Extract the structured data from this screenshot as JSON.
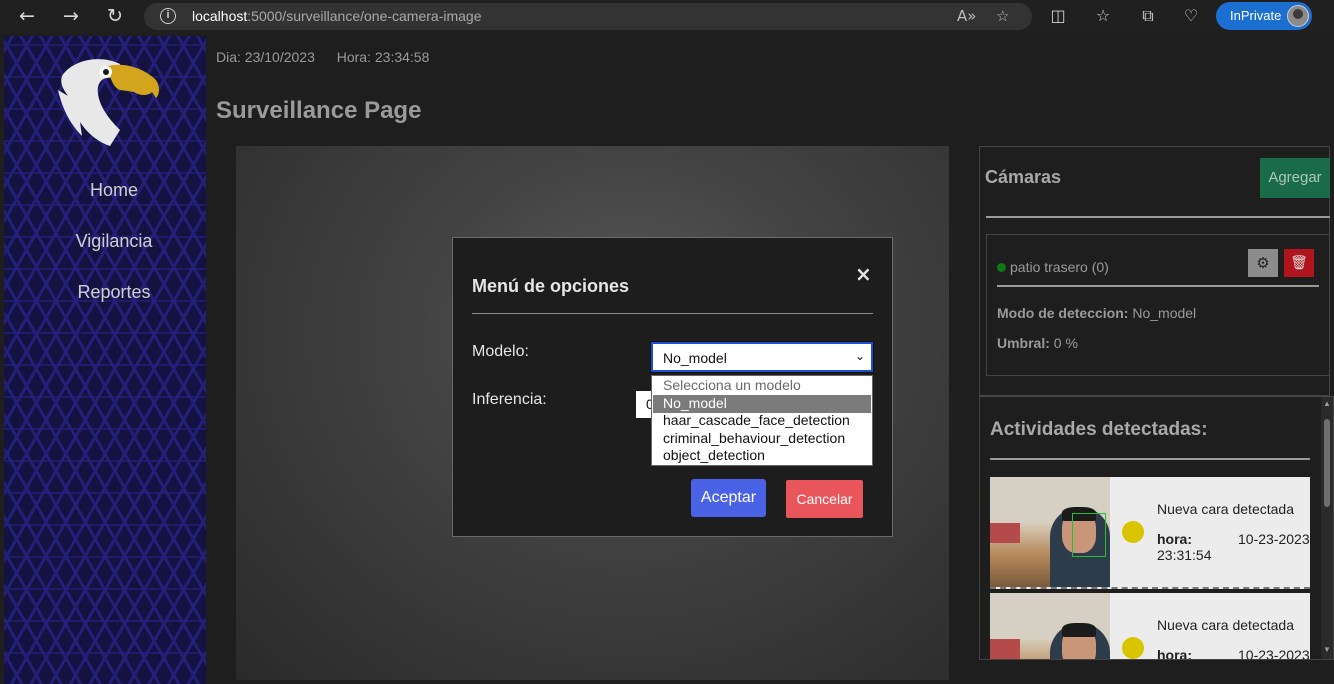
{
  "browser": {
    "url_host": "localhost",
    "url_path": ":5000/surveillance/one-camera-image",
    "inprivate_label": "InPrivate"
  },
  "sidebar": {
    "items": [
      {
        "label": "Home"
      },
      {
        "label": "Vigilancia"
      },
      {
        "label": "Reportes"
      }
    ]
  },
  "header": {
    "date": "Dia: 23/10/2023",
    "time": "Hora: 23:34:58",
    "title": "Surveillance Page"
  },
  "cameras": {
    "title": "Cámaras",
    "add_label": "Agregar",
    "card": {
      "name": "patio trasero (0)",
      "mode_label": "Modo de deteccion:",
      "mode_value": "No_model",
      "threshold_label": "Umbral:",
      "threshold_value": "0 %"
    }
  },
  "activities": {
    "title": "Actividades detectadas:",
    "items": [
      {
        "text": "Nueva cara detectada",
        "hora_label": "hora:",
        "date": "10-23-2023",
        "time": "23:31:54"
      },
      {
        "text": "Nueva cara detectada",
        "hora_label": "hora:",
        "date": "10-23-2023",
        "time": ""
      }
    ]
  },
  "modal": {
    "title": "Menú de opciones",
    "close": "×",
    "model_label": "Modelo:",
    "model_value": "No_model",
    "inference_label": "Inferencia:",
    "inference_value": "0",
    "options": [
      "Selecciona un modelo",
      "No_model",
      "haar_cascade_face_detection",
      "criminal_behaviour_detection",
      "object_detection"
    ],
    "selected_option": "No_model",
    "accept_label": "Aceptar",
    "cancel_label": "Cancelar"
  },
  "colors": {
    "accept": "#4a63e6",
    "cancel": "#e8555a",
    "add": "#1a6b4a",
    "delete": "#b0141c",
    "camera_online": "#0d7a17"
  }
}
